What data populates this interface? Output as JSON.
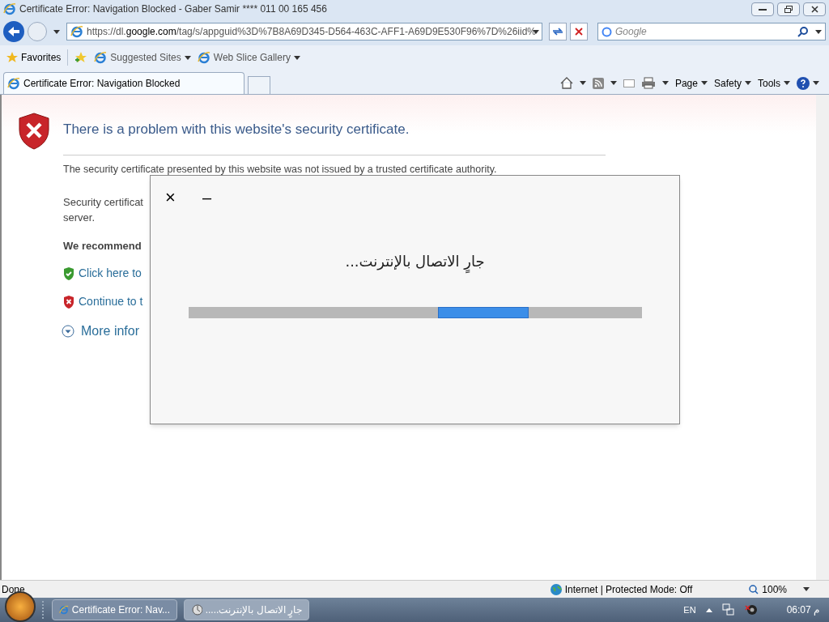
{
  "window": {
    "title": "Certificate Error: Navigation Blocked - Gaber Samir **** 011 00 165 456"
  },
  "address_bar": {
    "url_prefix": "https://dl.",
    "url_domain": "google.com",
    "url_rest": "/tag/s/appguid%3D%7B8A69D345-D564-463C-AFF1-A69D9E530F96%7D%26iid%"
  },
  "search": {
    "placeholder": "Google"
  },
  "favorites_bar": {
    "favorites": "Favorites",
    "links": [
      {
        "label": "Suggested Sites"
      },
      {
        "label": "Web Slice Gallery"
      }
    ]
  },
  "tabs": [
    {
      "label": "Certificate Error: Navigation Blocked",
      "selected": true
    }
  ],
  "command_bar": [
    "Page",
    "Safety",
    "Tools"
  ],
  "page": {
    "heading": "There is a problem with this website's security certificate.",
    "paragraph_1": "The security certificate presented by this website was not issued by a trusted certificate authority.",
    "paragraph_2_line_1": "Security certificat",
    "paragraph_2_line_2": "server.",
    "recommend": "We recommend",
    "links": [
      {
        "kind": "safe",
        "label": "Click here to"
      },
      {
        "kind": "unsafe",
        "label": "Continue to t"
      }
    ],
    "more_info": "More infor"
  },
  "dialog": {
    "close": "×",
    "minimize": "–",
    "message": "جارٍ الاتصال بالإنترنت..."
  },
  "status_bar": {
    "status": "Done",
    "zone": "Internet | Protected Mode: Off",
    "zoom": "100%"
  },
  "taskbar": {
    "buttons": [
      {
        "label": "Certificate Error: Nav...",
        "selected": false
      },
      {
        "label": "جارٍ الاتصال بالإنترنت.....",
        "selected": true
      }
    ],
    "language": "EN",
    "clock": "06:07 م"
  }
}
